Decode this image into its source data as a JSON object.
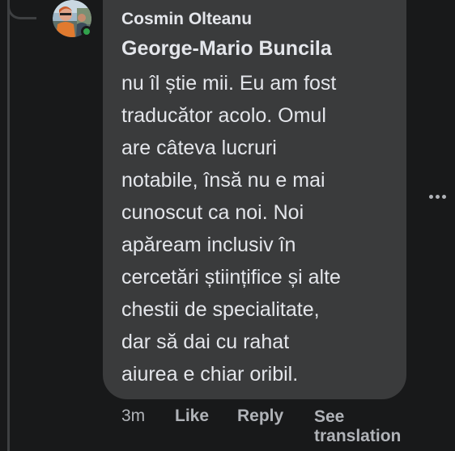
{
  "comment": {
    "author": "Cosmin Olteanu",
    "mention": "George-Mario Buncila",
    "body_lines": [
      "nu îl știe mii. Eu am fost",
      "traducător acolo. Omul",
      "are câteva lucruri",
      "notabile, însă nu e mai",
      "cunoscut ca noi. Noi",
      "apăream inclusiv în",
      "cercetări științifice și alte",
      "chestii de specialitate,",
      "dar să dai cu rahat",
      "aiurea e chiar oribil."
    ],
    "timestamp": "3m",
    "actions": {
      "like": "Like",
      "reply": "Reply",
      "see_translation_line1": "See",
      "see_translation_line2": "translation"
    }
  },
  "icons": {
    "more": "more-options-icon",
    "online": "online-status-icon"
  },
  "colors": {
    "background": "#18191a",
    "bubble": "#3a3b3c",
    "primary_text": "#e4e6eb",
    "secondary_text": "#b0b3b8",
    "online": "#31a24c",
    "thread_line": "#3e4042"
  }
}
